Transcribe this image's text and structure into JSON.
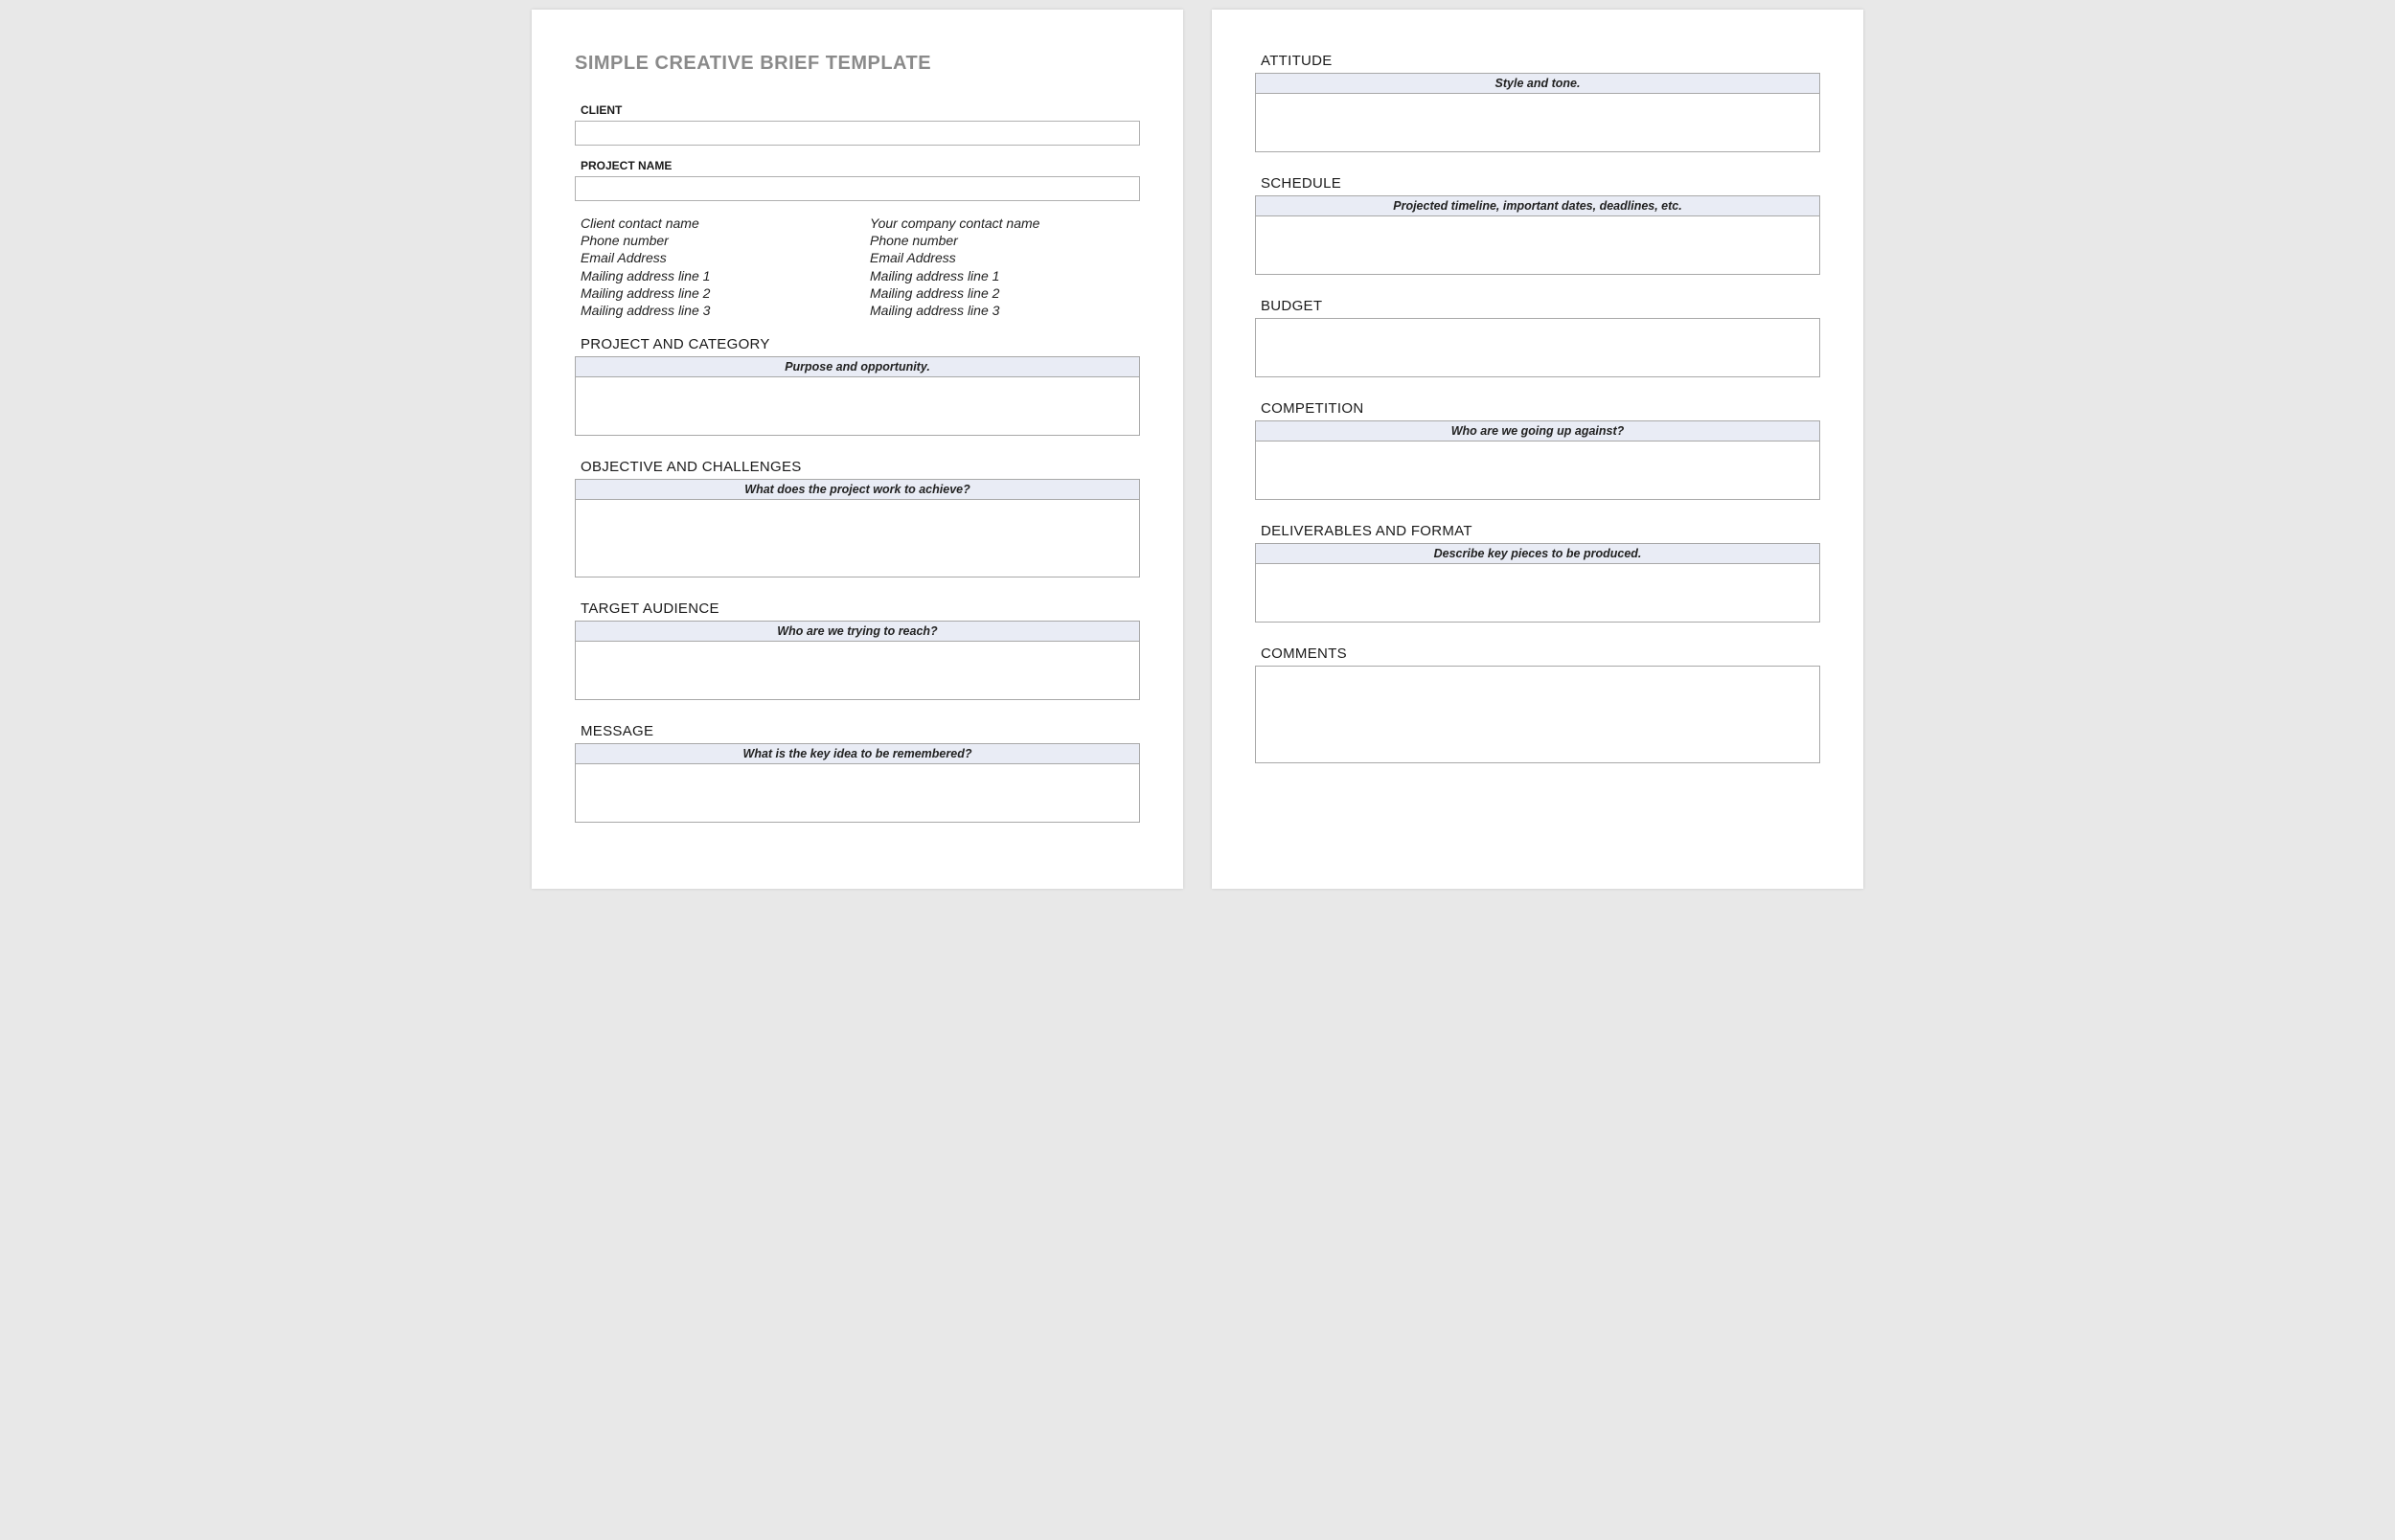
{
  "title": "SIMPLE CREATIVE BRIEF TEMPLATE",
  "fields": {
    "client_label": "CLIENT",
    "client_value": "",
    "project_name_label": "PROJECT NAME",
    "project_name_value": ""
  },
  "contacts": {
    "left": [
      "Client contact name",
      "Phone number",
      "Email Address",
      "Mailing address line 1",
      "Mailing address line 2",
      "Mailing address line 3"
    ],
    "right": [
      "Your company contact name",
      "Phone number",
      "Email Address",
      "Mailing address line 1",
      "Mailing address line 2",
      "Mailing address line 3"
    ]
  },
  "sections": {
    "project_category": {
      "title": "PROJECT AND CATEGORY",
      "hint": "Purpose and opportunity."
    },
    "objective": {
      "title": "OBJECTIVE AND CHALLENGES",
      "hint": "What does the project work to achieve?"
    },
    "audience": {
      "title": "TARGET AUDIENCE",
      "hint": "Who are we trying to reach?"
    },
    "message": {
      "title": "MESSAGE",
      "hint": "What is the key idea to be remembered?"
    },
    "attitude": {
      "title": "ATTITUDE",
      "hint": "Style and tone."
    },
    "schedule": {
      "title": "SCHEDULE",
      "hint": "Projected timeline, important dates, deadlines, etc."
    },
    "budget": {
      "title": "BUDGET"
    },
    "competition": {
      "title": "COMPETITION",
      "hint": "Who are we going up against?"
    },
    "deliverables": {
      "title": "DELIVERABLES AND FORMAT",
      "hint": "Describe key pieces to be produced."
    },
    "comments": {
      "title": "COMMENTS"
    }
  }
}
